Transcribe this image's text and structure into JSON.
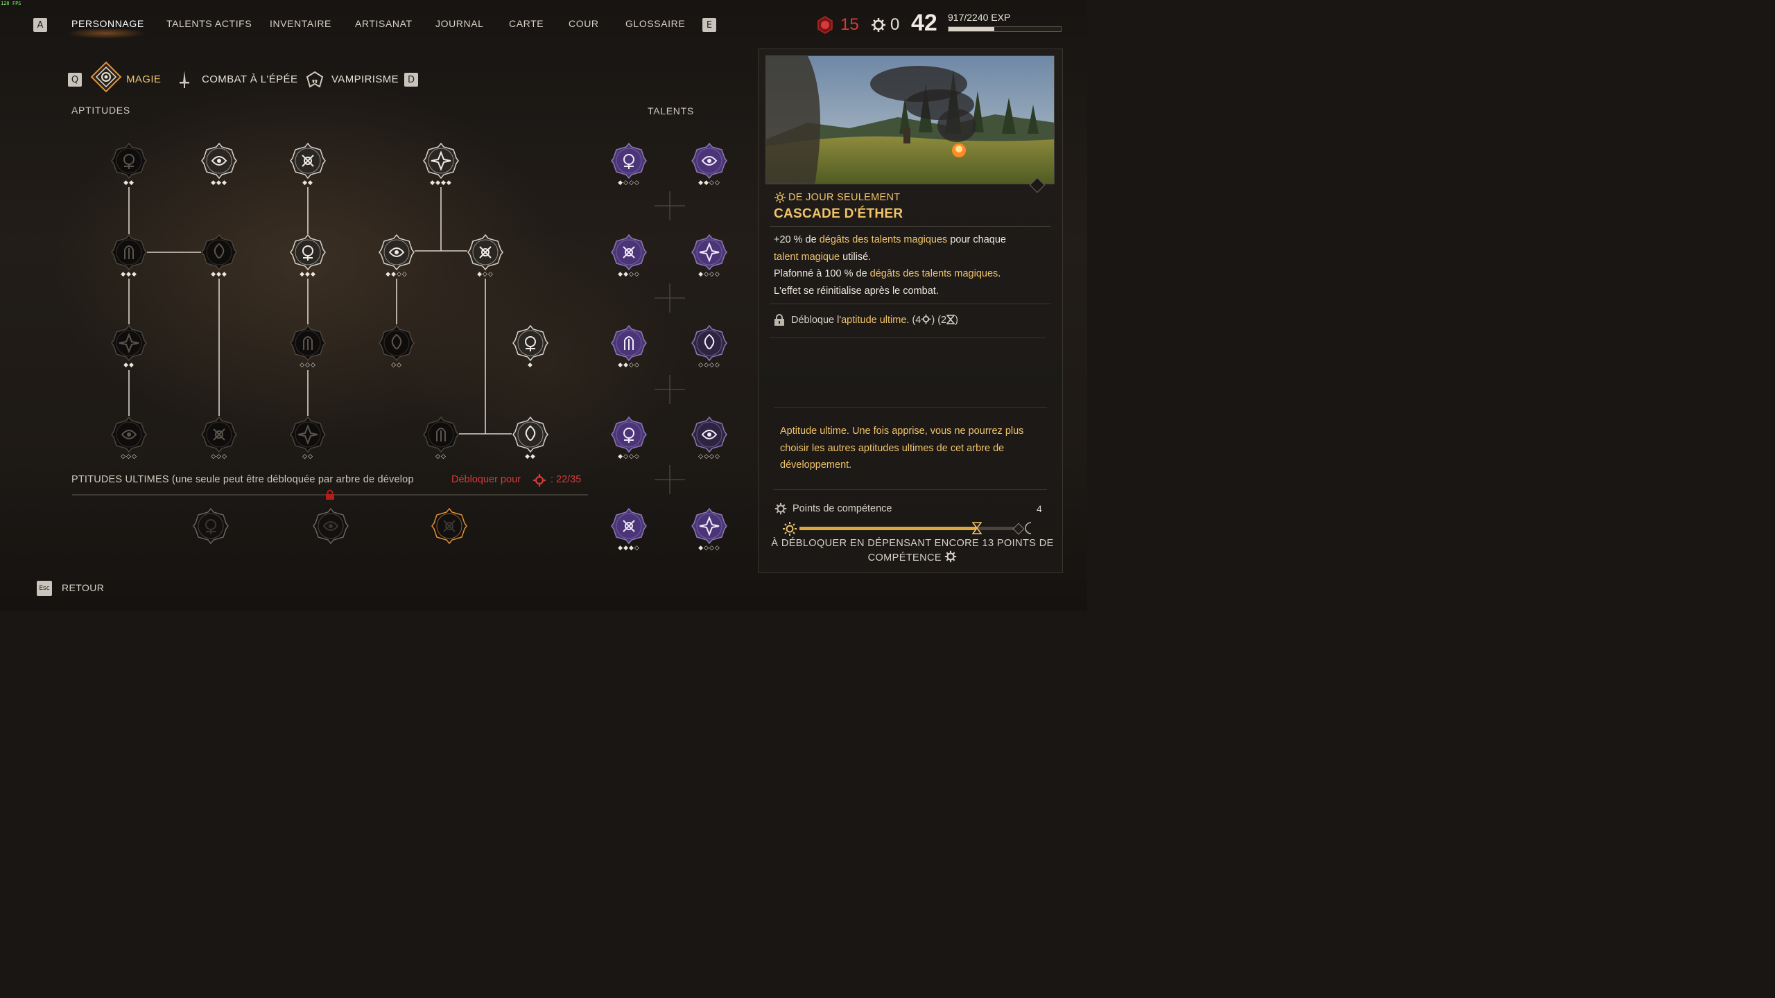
{
  "overlay": {
    "fps": "120 FPS"
  },
  "nav": {
    "left_key": "A",
    "right_key": "E",
    "items": [
      "PERSONNAGE",
      "TALENTS ACTIFS",
      "INVENTAIRE",
      "ARTISANAT",
      "JOURNAL",
      "CARTE",
      "COUR",
      "GLOSSAIRE"
    ],
    "active": "PERSONNAGE"
  },
  "stats": {
    "blood_points": "15",
    "skill_points": "0",
    "level": "42",
    "exp": "917/2240 EXP",
    "exp_progress": 0.41,
    "blood_color": "#d63a3a"
  },
  "tabs": {
    "left_key": "Q",
    "right_key": "D",
    "items": [
      "MAGIE",
      "COMBAT À L'ÉPÉE",
      "VAMPIRISME"
    ],
    "active": "MAGIE"
  },
  "sections": {
    "abilities": "APTITUDES",
    "talents": "TALENTS",
    "ultimates": "PTITUDES ULTIMES (une seule peut être débloquée par arbre de dévelop",
    "unlock_prefix": "Débloquer pour",
    "unlock_value": ": 22/35"
  },
  "ability_nodes": [
    {
      "icon": "dagger-strike-icon",
      "dots": "◆◆",
      "lit": false
    },
    {
      "icon": "radiant-eye-icon",
      "dots": "◆◆◆",
      "lit": true
    },
    {
      "icon": "shield-swirl-icon",
      "dots": "◆◆",
      "lit": true
    },
    {
      "icon": "eye-hand-icon",
      "dots": "◆◆◆◆",
      "lit": true
    },
    {
      "icon": "mortar-icon",
      "dots": "◆◆◆",
      "lit": false
    },
    {
      "icon": "crossed-tools-icon",
      "dots": "◆◆◆",
      "lit": false
    },
    {
      "icon": "ankh-lock-icon",
      "dots": "◆◆◆",
      "lit": true
    },
    {
      "icon": "skull-crossbones-icon",
      "dots": "◆◆◇◇",
      "lit": true
    },
    {
      "icon": "cross-spark-icon",
      "dots": "◆◇◇",
      "lit": true
    },
    {
      "icon": "totem-icon",
      "dots": "◆◆",
      "lit": false
    },
    {
      "icon": "watching-eye-icon",
      "dots": "◇◇◇",
      "lit": false
    },
    {
      "icon": "flame-circle-icon",
      "dots": "◇◇",
      "lit": false
    },
    {
      "icon": "tree-root-icon",
      "dots": "◆",
      "lit": true
    },
    {
      "icon": "chalice-icon",
      "dots": "◇◇◇",
      "lit": false
    },
    {
      "icon": "hunter-horn-icon",
      "dots": "◇◇◇",
      "lit": false
    },
    {
      "icon": "spiral-vortex-icon",
      "dots": "◇◇",
      "lit": false
    },
    {
      "icon": "droplet-icon",
      "dots": "◇◇",
      "lit": false
    },
    {
      "icon": "burning-skull-icon",
      "dots": "◆◆",
      "lit": true
    }
  ],
  "talent_nodes": [
    {
      "icon": "poison-skull-icon",
      "dots": "◆◇◇◇"
    },
    {
      "icon": "rune-stone-icon",
      "dots": "◆◆◇◇"
    },
    {
      "icon": "fire-burst-icon",
      "dots": "◆◆◇◇"
    },
    {
      "icon": "star-burst-icon",
      "dots": "◆◇◇◇"
    },
    {
      "icon": "magic-hand-icon",
      "dots": "◆◆◇◇"
    },
    {
      "icon": "bat-wings-icon",
      "dots": "◇◇◇◇"
    },
    {
      "icon": "glowing-palm-icon",
      "dots": "◆◇◇◇"
    },
    {
      "icon": "tree-sigil-icon",
      "dots": "◇◇◇◇"
    },
    {
      "icon": "serpent-icon",
      "dots": "◆◆◆◇"
    },
    {
      "icon": "running-figure-icon",
      "dots": "◆◇◇◇"
    }
  ],
  "ultimate_nodes": [
    {
      "icon": "dragon-rune-icon"
    },
    {
      "icon": "shadow-crown-icon"
    },
    {
      "icon": "ether-cascade-icon"
    }
  ],
  "detail": {
    "tag": "DE JOUR SEULEMENT",
    "title": "CASCADE D'ÉTHER",
    "line1_a": "+20 % de ",
    "line1_b": "dégâts des talents magiques",
    "line1_c": " pour chaque",
    "line2_a": "talent magique",
    "line2_b": " utilisé.",
    "line3_a": "Plafonné à 100 % de ",
    "line3_b": "dégâts des talents magiques",
    "line3_c": ".",
    "line4": "L'effet se réinitialise après le combat.",
    "unlock_a": "Débloque l'",
    "unlock_b": "aptitude ultime",
    "unlock_c": ".  (4",
    "unlock_d": ") (2",
    "unlock_e": ")",
    "ultimate_note": "Aptitude ultime. Une fois apprise, vous ne pourrez plus choisir les autres aptitudes ultimes de cet arbre de développement.",
    "points_label": "Points de compétence",
    "points_value": "4",
    "points_progress": 0.82,
    "unlock_footer": "À DÉBLOQUER EN DÉPENSANT ENCORE 13 POINTS DE COMPÉTENCE"
  },
  "footer": {
    "key": "Esc",
    "label": "RETOUR"
  },
  "colors": {
    "gold": "#f2c46a",
    "accent_orange": "#e0913a",
    "red": "#d63a3a",
    "talent_purple": "#5b3f8a"
  }
}
